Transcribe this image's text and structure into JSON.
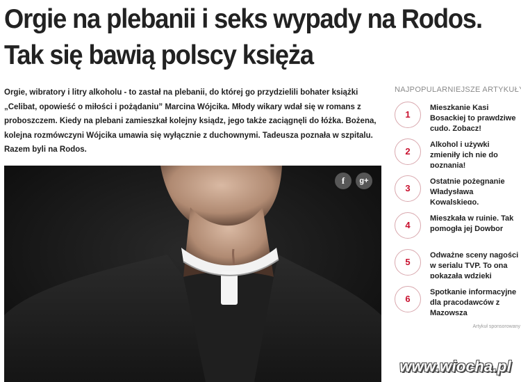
{
  "article": {
    "headline_line1": "Orgie na plebanii i seks wypady na Rodos.",
    "headline_line2": "Tak się bawią polscy księża",
    "lead": "Orgie, wibratory i litry alkoholu - to zastał na plebanii, do której go przydzielili bohater książki „Celibat, opowieść o miłości i pożądaniu” Marcina Wójcika. Młody wikary wdał się w romans z proboszczem. Kiedy na plebani zamieszkał kolejny ksiądz, jego także zaciągnęli do łóżka. Bożena, kolejna rozmówczyni Wójcika umawia się wyłącznie z duchownymi. Tadeusza poznała w szpitalu. Razem byli na Rodos."
  },
  "share": {
    "facebook_glyph": "f",
    "googleplus_glyph": "g+",
    "icons": [
      "facebook-icon",
      "google-plus-icon"
    ]
  },
  "sidebar": {
    "title": "NAJPOPULARNIEJSZE ARTYKUŁY:",
    "items": [
      {
        "num": "1",
        "text": "Mieszkanie Kasi Bosackiej to prawdziwe cudo. Zobacz!"
      },
      {
        "num": "2",
        "text": "Alkohol i używki zmieniły ich nie do poznania!"
      },
      {
        "num": "3",
        "text": "Ostatnie pożegnanie Władysława Kowalskiego."
      },
      {
        "num": "4",
        "text": "Mieszkała w ruinie. Tak pomogła jej Dowbor"
      },
      {
        "num": "5",
        "text": "Odważne sceny nagości w serialu TVP. To ona pokazała wdzięki"
      },
      {
        "num": "6",
        "text": "Spotkanie informacyjne dla pracodawców z Mazowsza"
      }
    ],
    "sponsored_label": "Artykuł sponsorowany"
  },
  "watermark": "www.wiocha.pl",
  "colors": {
    "accent": "#c8102e",
    "circle_border": "#d9a8ae",
    "text": "#1e1e1e",
    "muted": "#8a8a8a"
  }
}
